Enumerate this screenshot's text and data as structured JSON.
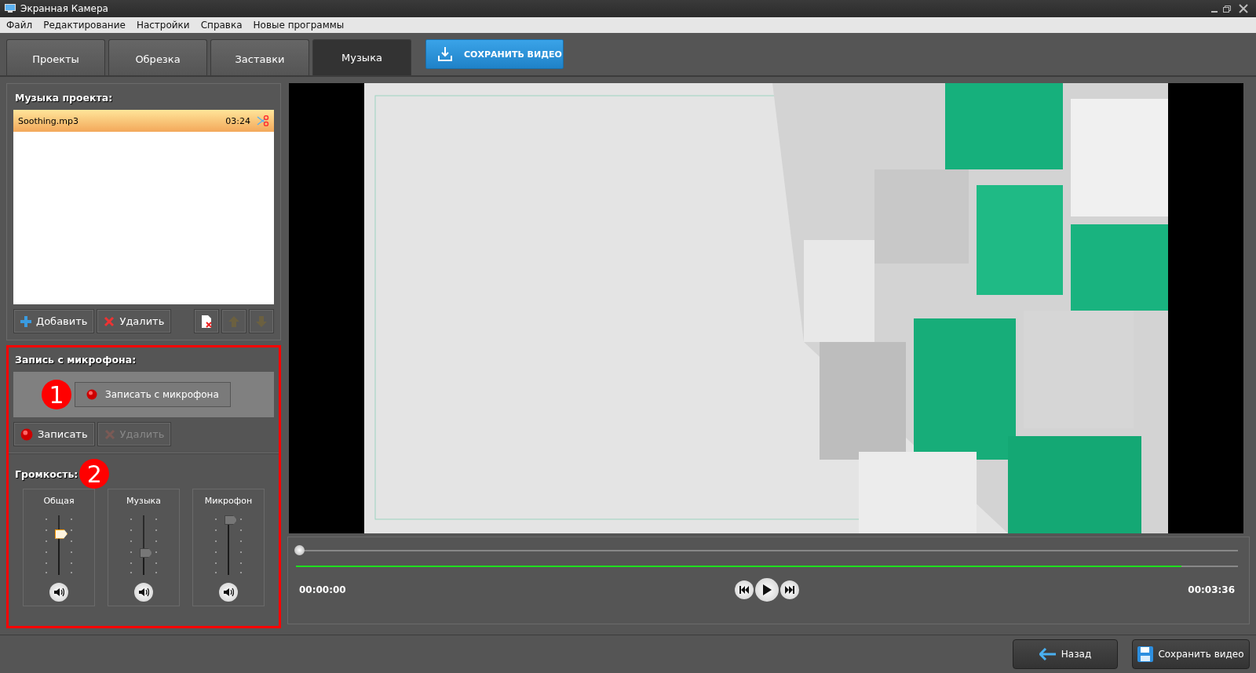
{
  "window": {
    "title": "Экранная Камера"
  },
  "menu": [
    "Файл",
    "Редактирование",
    "Настройки",
    "Справка",
    "Новые программы"
  ],
  "tabs": [
    {
      "label": "Проекты",
      "selected": false
    },
    {
      "label": "Обрезка",
      "selected": false
    },
    {
      "label": "Заставки",
      "selected": false
    },
    {
      "label": "Музыка",
      "selected": true
    }
  ],
  "save_top_button": "СОХРАНИТЬ ВИДЕО",
  "project_music": {
    "title": "Музыка проекта:",
    "tracks": [
      {
        "name": "Soothing.mp3",
        "duration": "03:24",
        "selected": true
      }
    ],
    "buttons": [
      "Добавить",
      "Удалить"
    ]
  },
  "microphone": {
    "title": "Запись с микрофона:",
    "record_from_mic_button": "Записать с микрофона",
    "record_button": "Записать",
    "delete_button": {
      "label": "Удалить",
      "disabled": true
    }
  },
  "volume": {
    "title": "Громкость:",
    "channels": [
      {
        "name": "Общая",
        "level": 0.75,
        "active": true
      },
      {
        "name": "Музыка",
        "level": 0.4,
        "active": false
      },
      {
        "name": "Микрофон",
        "level": 1,
        "active": false
      }
    ]
  },
  "annotations": [
    "1",
    "2"
  ],
  "player": {
    "seek": {
      "level": 0
    },
    "music_bar": {
      "level": 0.94
    },
    "time_start": "00:00:00",
    "time_end": "00:03:36"
  },
  "bottom_buttons": [
    "Назад",
    "Сохранить видео"
  ]
}
